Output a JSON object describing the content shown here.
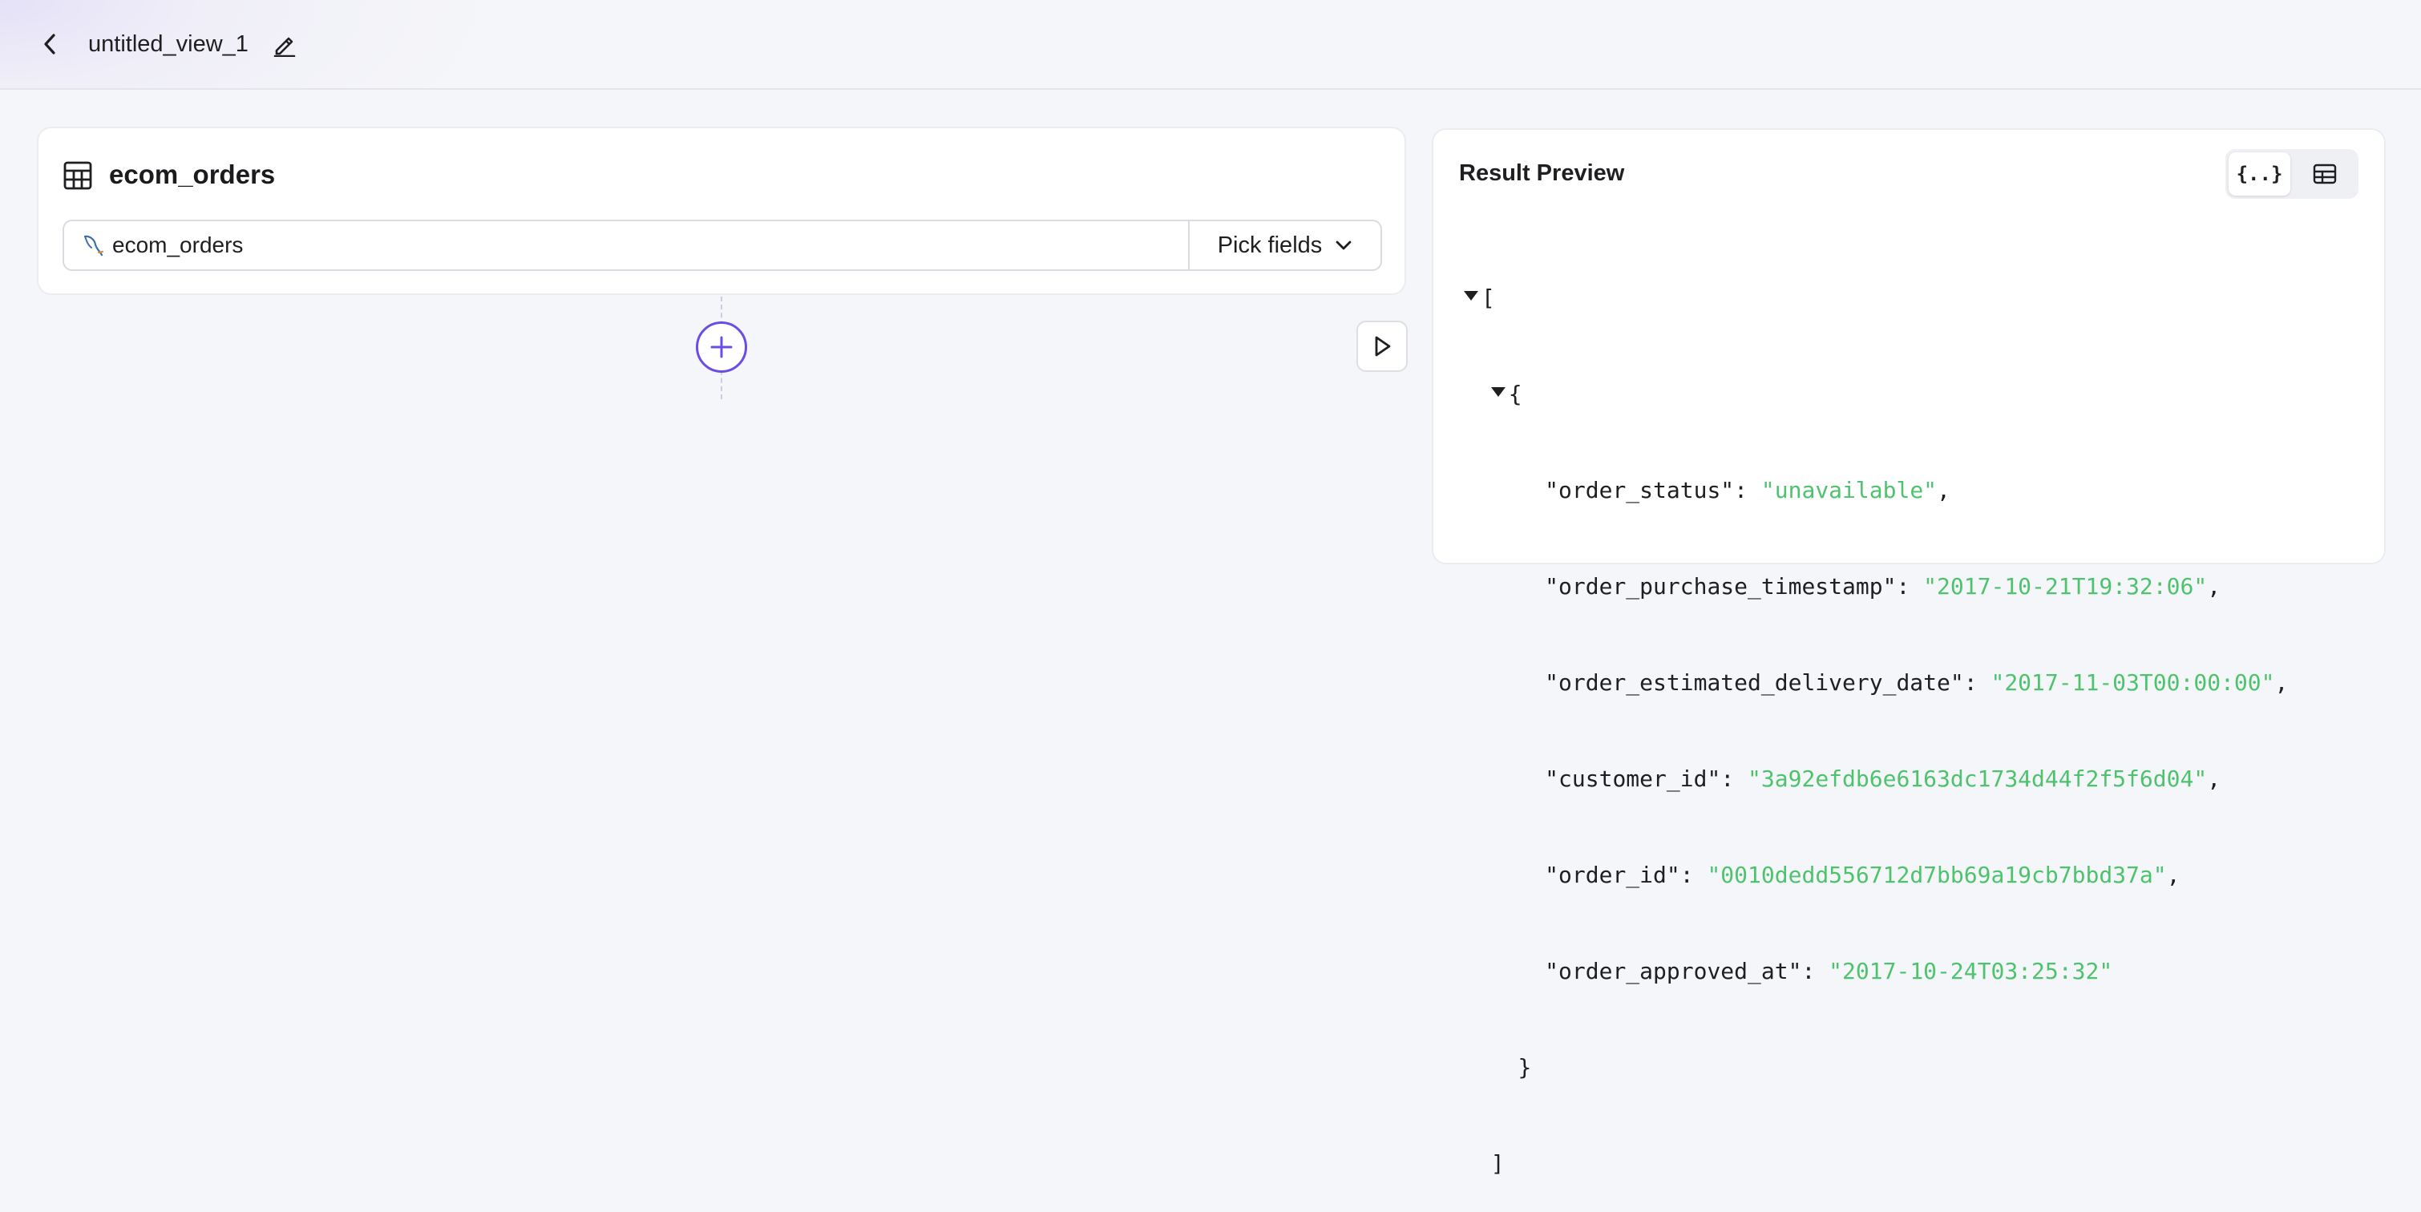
{
  "header": {
    "title": "untitled_view_1"
  },
  "source": {
    "title": "ecom_orders",
    "selected_source": "ecom_orders",
    "pick_fields_label": "Pick fields"
  },
  "preview": {
    "title": "Result Preview",
    "json_toggle_label": "{..}",
    "open_bracket": "[",
    "close_bracket": "]",
    "open_brace": "{",
    "close_brace": "}",
    "record": [
      {
        "key": "\"order_status\"",
        "value": "\"unavailable\"",
        "sep": ","
      },
      {
        "key": "\"order_purchase_timestamp\"",
        "value": "\"2017-10-21T19:32:06\"",
        "sep": ","
      },
      {
        "key": "\"order_estimated_delivery_date\"",
        "value": "\"2017-11-03T00:00:00\"",
        "sep": ","
      },
      {
        "key": "\"customer_id\"",
        "value": "\"3a92efdb6e6163dc1734d44f2f5f6d04\"",
        "sep": ","
      },
      {
        "key": "\"order_id\"",
        "value": "\"0010dedd556712d7bb69a19cb7bbd37a\"",
        "sep": ","
      },
      {
        "key": "\"order_approved_at\"",
        "value": "\"2017-10-24T03:25:32\"",
        "sep": ""
      }
    ]
  },
  "colors": {
    "accent": "#6b4de6",
    "json_string": "#4ec36d"
  }
}
